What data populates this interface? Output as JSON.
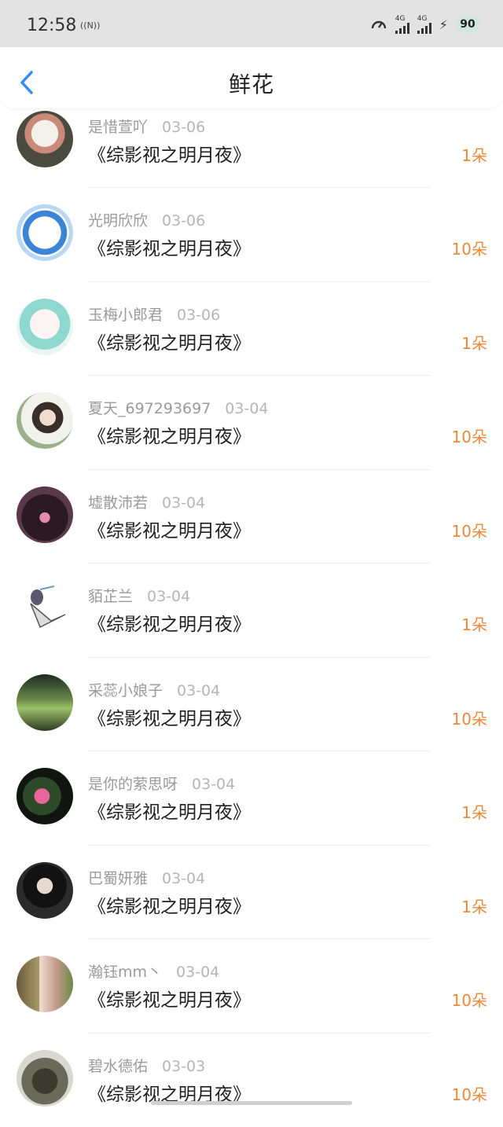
{
  "status_bar": {
    "time": "12:58",
    "nfc": "((N))",
    "signal1": "4G",
    "signal2": "4G",
    "battery": "90"
  },
  "header": {
    "title": "鲜花"
  },
  "items": [
    {
      "user": "是惜萱吖",
      "date": "03-06",
      "book": "《综影视之明月夜》",
      "count": "1朵"
    },
    {
      "user": "光明欣欣",
      "date": "03-06",
      "book": "《综影视之明月夜》",
      "count": "10朵"
    },
    {
      "user": "玉梅小郎君",
      "date": "03-06",
      "book": "《综影视之明月夜》",
      "count": "1朵"
    },
    {
      "user": "夏天_697293697",
      "date": "03-04",
      "book": "《综影视之明月夜》",
      "count": "10朵"
    },
    {
      "user": "墟散沛若",
      "date": "03-04",
      "book": "《综影视之明月夜》",
      "count": "10朵"
    },
    {
      "user": "貊芷兰",
      "date": "03-04",
      "book": "《综影视之明月夜》",
      "count": "1朵"
    },
    {
      "user": "采蕊小娘子",
      "date": "03-04",
      "book": "《综影视之明月夜》",
      "count": "10朵"
    },
    {
      "user": "是你的萦思呀",
      "date": "03-04",
      "book": "《综影视之明月夜》",
      "count": "1朵"
    },
    {
      "user": "巴蜀妍雅",
      "date": "03-04",
      "book": "《综影视之明月夜》",
      "count": "1朵"
    },
    {
      "user": "瀚钰mm丶",
      "date": "03-04",
      "book": "《综影视之明月夜》",
      "count": "10朵"
    },
    {
      "user": "碧水德佑",
      "date": "03-03",
      "book": "《综影视之明月夜》",
      "count": "10朵"
    }
  ],
  "colors": {
    "accent": "#f0883a",
    "back_arrow": "#2f8ef5"
  }
}
